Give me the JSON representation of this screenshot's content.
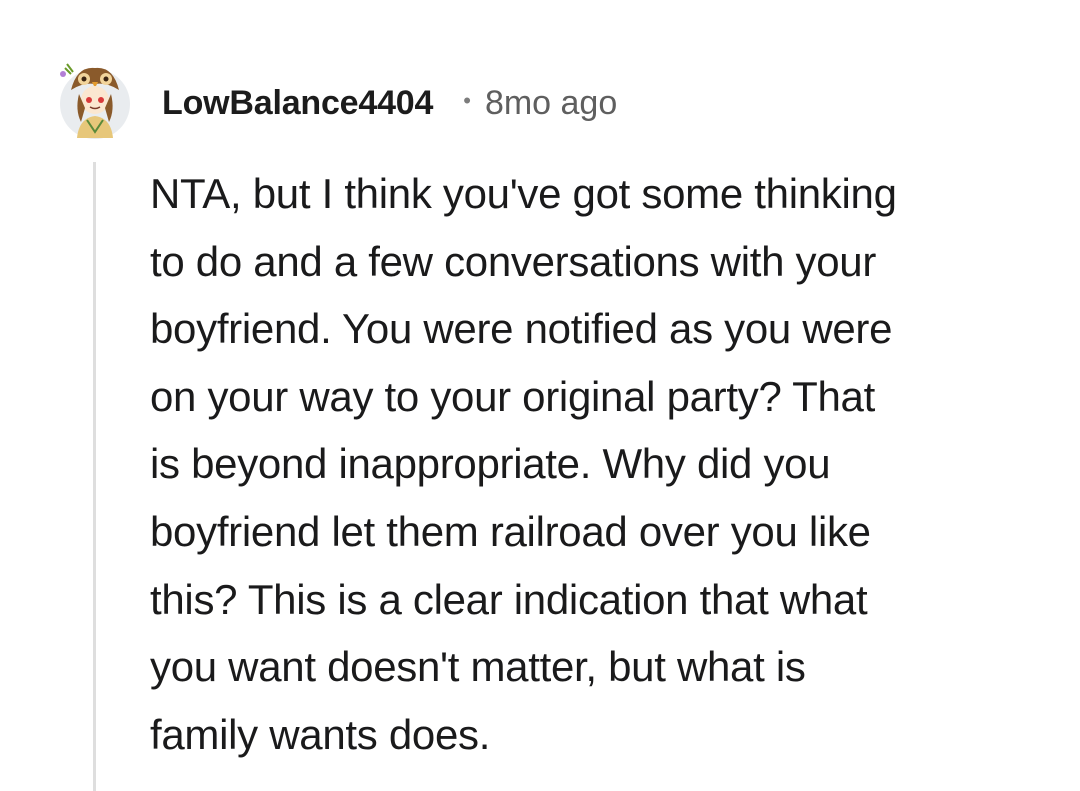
{
  "comment": {
    "username": "LowBalance4404",
    "separator": "•",
    "timestamp": "8mo ago",
    "avatar_icon": "owl-hat-avatar-icon",
    "body_lines": [
      "NTA, but I think you've got some thinking",
      "to do and a few conversations with your",
      "boyfriend. You were notified as you were",
      "on your way to your original party? That",
      "is beyond inappropriate. Why did you",
      "boyfriend let them railroad over you like",
      "this? This is a clear indication that what",
      "you want doesn't matter, but what is",
      "family wants does."
    ]
  },
  "colors": {
    "text": "#1a1a1b",
    "muted": "#5f5f5f",
    "thread_line": "#dedede",
    "background": "#ffffff"
  }
}
